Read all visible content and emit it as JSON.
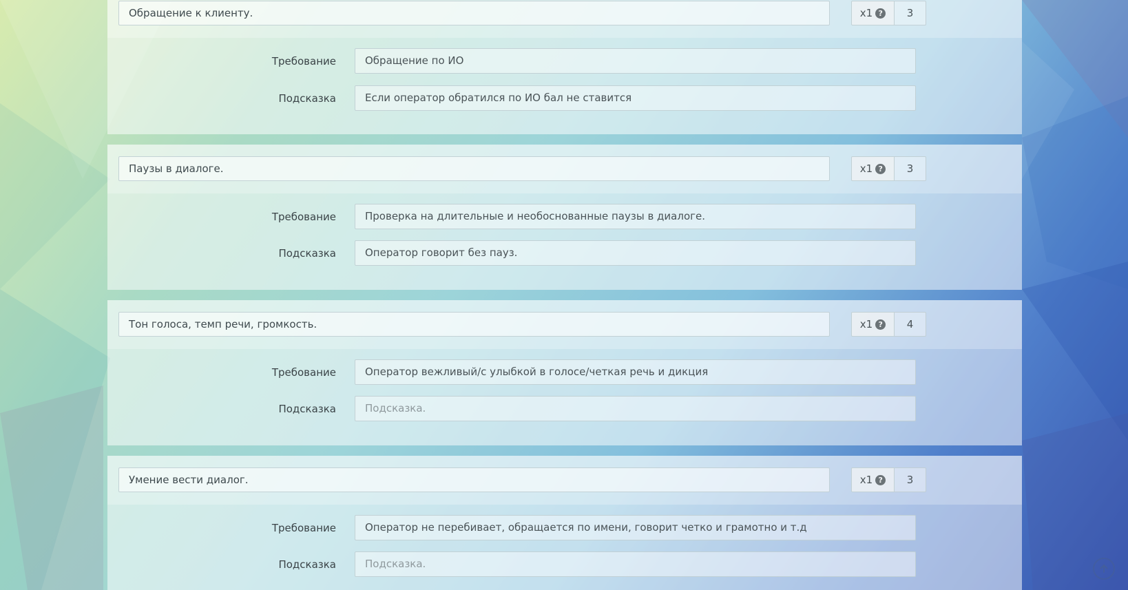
{
  "criteria": [
    {
      "title": "Обращение к клиенту.",
      "weight_label": "x1",
      "score": "3",
      "requirement_label": "Требование",
      "requirement": "Обращение по ИО",
      "hint_label": "Подсказка",
      "hint": "Если оператор  обратился по ИО бал не ставится",
      "hint_is_placeholder": false
    },
    {
      "title": "Паузы в диалоге.",
      "weight_label": "x1",
      "score": "3",
      "requirement_label": "Требование",
      "requirement": "Проверка на длительные и необоснованные паузы в диалоге.",
      "hint_label": "Подсказка",
      "hint": "Оператор говорит без пауз.",
      "hint_is_placeholder": false
    },
    {
      "title": "Тон голоса, темп речи, громкость.",
      "weight_label": "x1",
      "score": "4",
      "requirement_label": "Требование",
      "requirement": "Оператор вежливый/с улыбкой в голосе/четкая речь и дикция",
      "hint_label": "Подсказка",
      "hint": "Подсказка.",
      "hint_is_placeholder": true
    },
    {
      "title": "Умение вести диалог.",
      "weight_label": "x1",
      "score": "3",
      "requirement_label": "Требование",
      "requirement": "Оператор не перебивает,  обращается по имени, говорит четко и грамотно и т.д",
      "hint_label": "Подсказка",
      "hint": "Подсказка.",
      "hint_is_placeholder": true
    }
  ],
  "icons": {
    "help": "question-circle-icon",
    "scroll_top": "arrow-up-icon"
  }
}
